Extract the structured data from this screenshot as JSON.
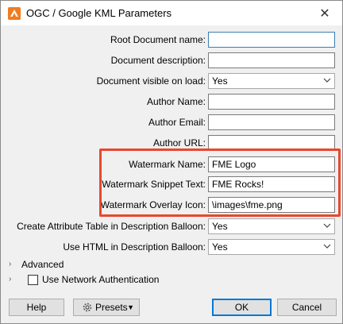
{
  "window": {
    "title": "OGC / Google KML Parameters",
    "close_glyph": "✕",
    "app_icon": "fme-app-icon"
  },
  "form": {
    "root_document_name": {
      "label": "Root Document name:",
      "value": ""
    },
    "document_description": {
      "label": "Document description:",
      "value": ""
    },
    "document_visible_on_load": {
      "label": "Document visible on load:",
      "value": "Yes"
    },
    "author_name": {
      "label": "Author Name:",
      "value": ""
    },
    "author_email": {
      "label": "Author Email:",
      "value": ""
    },
    "author_url": {
      "label": "Author URL:",
      "value": ""
    },
    "watermark_name": {
      "label": "Watermark Name:",
      "value": "FME Logo"
    },
    "watermark_snippet_text": {
      "label": "Watermark Snippet Text:",
      "value": "FME Rocks!"
    },
    "watermark_overlay_icon": {
      "label": "Watermark Overlay Icon:",
      "value": "\\images\\fme.png"
    },
    "create_attribute_table": {
      "label": "Create Attribute Table in Description Balloon:",
      "value": "Yes"
    },
    "use_html_in_balloon": {
      "label": "Use HTML in Description Balloon:",
      "value": "Yes"
    }
  },
  "sections": {
    "advanced": {
      "label": "Advanced",
      "arrow": "›"
    },
    "network_auth": {
      "label": "Use Network Authentication",
      "arrow": "›",
      "checked": false
    }
  },
  "buttons": {
    "help": "Help",
    "presets": "Presets",
    "presets_caret": "▼",
    "ok": "OK",
    "cancel": "Cancel"
  },
  "colors": {
    "highlight": "#e8472d",
    "focus_border": "#0078d7"
  }
}
